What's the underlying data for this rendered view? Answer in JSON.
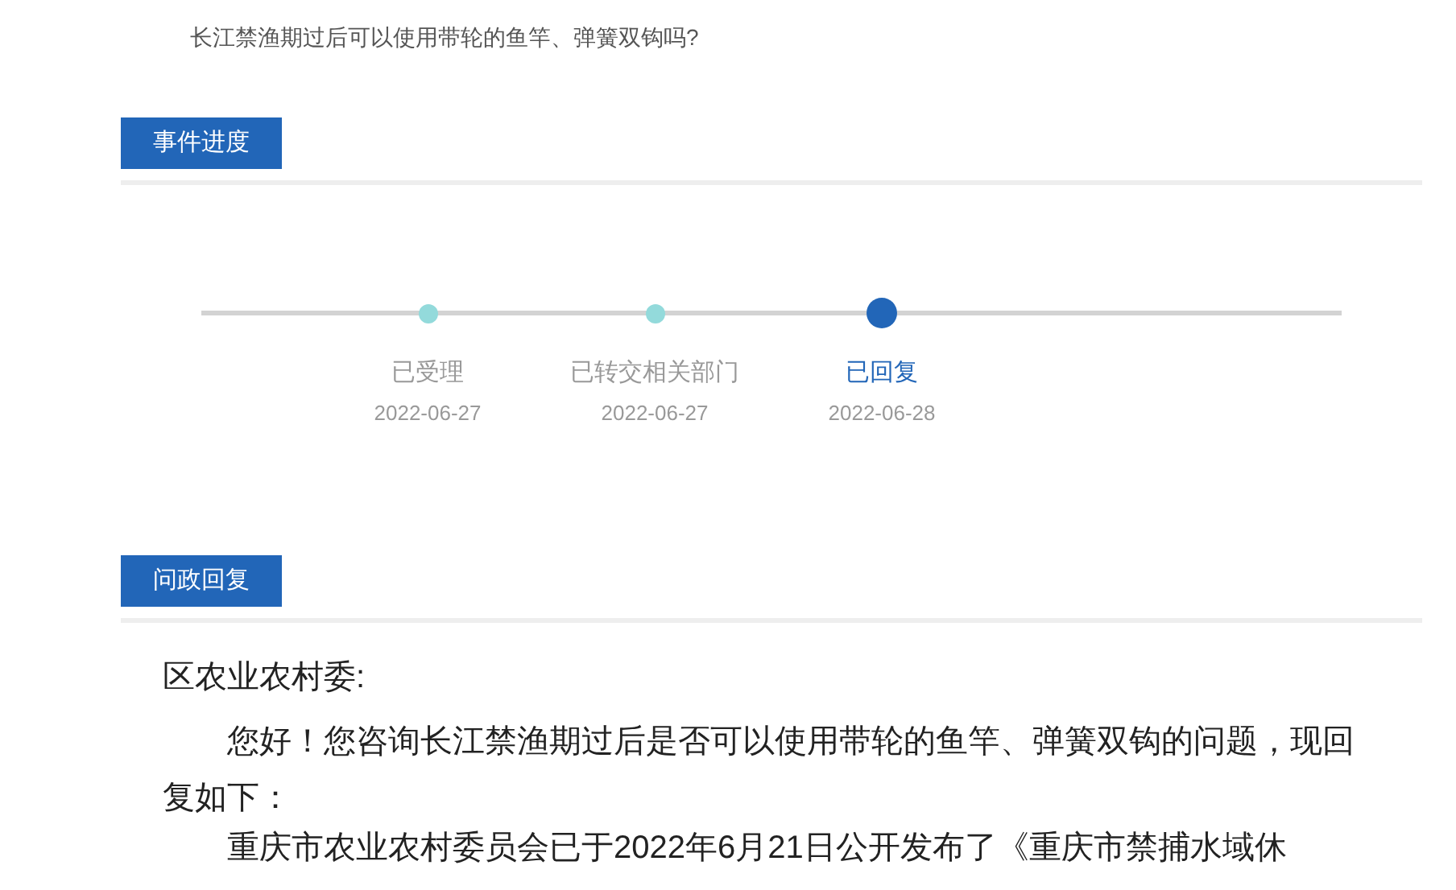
{
  "question": "长江禁渔期过后可以使用带轮的鱼竿、弹簧双钩吗?",
  "progress": {
    "heading": "事件进度",
    "steps": [
      {
        "label": "已受理",
        "date": "2022-06-27",
        "current": false
      },
      {
        "label": "已转交相关部门",
        "date": "2022-06-27",
        "current": false
      },
      {
        "label": "已回复",
        "date": "2022-06-28",
        "current": true
      }
    ]
  },
  "reply": {
    "heading": "问政回复",
    "salutation": "区农业农村委:",
    "paragraphs": [
      "您好！您咨询长江禁渔期过后是否可以使用带轮的鱼竿、弹簧双钩的问题，现回复如下：",
      "重庆市农业农村委员会已于2022年6月21日公开发布了《重庆市禁捕水域休"
    ]
  }
}
